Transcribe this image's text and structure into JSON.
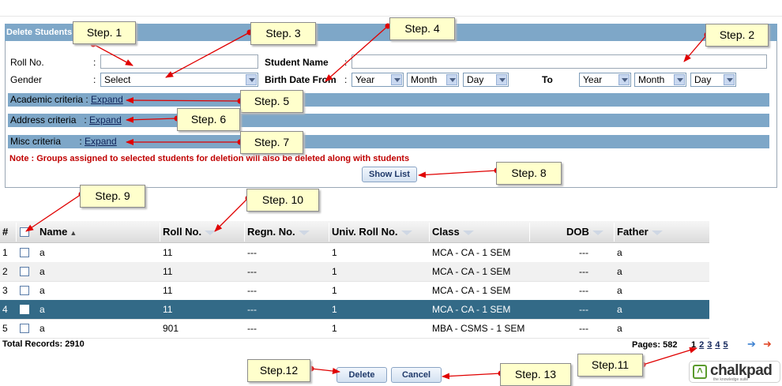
{
  "panel": {
    "title": "Delete Students"
  },
  "form": {
    "roll_label": "Roll No.",
    "colon": ":",
    "student_name_label": "Student Name",
    "gender_label": "Gender",
    "gender_value": "Select",
    "birth_from_label": "Birth Date From",
    "year": "Year",
    "month": "Month",
    "day": "Day",
    "to_label": "To"
  },
  "criteria": [
    {
      "label": "Academic criteria",
      "link": "Expand"
    },
    {
      "label": "Address criteria",
      "link": "Expand"
    },
    {
      "label": "Misc criteria",
      "link": "Expand"
    }
  ],
  "note": "Note : Groups assigned to selected students for deletion will also be deleted along with students",
  "buttons": {
    "show_list": "Show List",
    "delete": "Delete",
    "cancel": "Cancel"
  },
  "table": {
    "headers": [
      "#",
      "Name",
      "Roll No.",
      "Regn. No.",
      "Univ. Roll No.",
      "Class",
      "DOB",
      "Father"
    ],
    "rows": [
      [
        "1",
        "a",
        "11",
        "---",
        "1",
        "MCA - CA - 1 SEM",
        "---",
        "a"
      ],
      [
        "2",
        "a",
        "11",
        "---",
        "1",
        "MCA - CA - 1 SEM",
        "---",
        "a"
      ],
      [
        "3",
        "a",
        "11",
        "---",
        "1",
        "MCA - CA - 1 SEM",
        "---",
        "a"
      ],
      [
        "4",
        "a",
        "11",
        "---",
        "1",
        "MCA - CA - 1 SEM",
        "---",
        "a"
      ],
      [
        "5",
        "a",
        "901",
        "---",
        "1",
        "MBA - CSMS - 1 SEM",
        "---",
        "a"
      ]
    ],
    "total_records": "Total Records: 2910",
    "pages_label": "Pages: 582",
    "pages": [
      "1",
      "2",
      "3",
      "4",
      "5"
    ]
  },
  "steps": [
    "Step. 1",
    "Step. 2",
    "Step. 3",
    "Step. 4",
    "Step. 5",
    "Step. 6",
    "Step. 7",
    "Step. 8",
    "Step. 9",
    "Step. 10",
    "Step.11",
    "Step.12",
    "Step. 13"
  ],
  "logo": {
    "brand": "chalkpad",
    "tagline": "the knowledge suite"
  },
  "colors": {
    "header_bar": "#7ea7c8",
    "selected_row": "#336a87",
    "note": "#c00000",
    "arrow": "#e00000",
    "callout": "#ffffcc"
  }
}
